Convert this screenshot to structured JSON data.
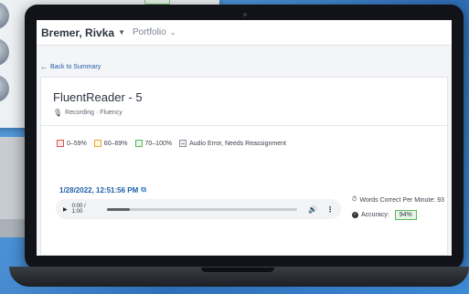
{
  "header": {
    "student_name": "Bremer, Rivka",
    "portfolio_label": "Portfolio"
  },
  "nav": {
    "back_label": "Back to Summary"
  },
  "assessment": {
    "title": "FluentReader - 5",
    "subtitle": "Recording · Fluency"
  },
  "legend": [
    {
      "label": "0–59%",
      "color": "#d9534f"
    },
    {
      "label": "60–69%",
      "color": "#e6a93a"
    },
    {
      "label": "70–100%",
      "color": "#5cb85c"
    },
    {
      "label": "Audio Error, Needs Reassignment",
      "color": "#8a929c"
    }
  ],
  "recording": {
    "timestamp": "1/28/2022, 12:51:56 PM",
    "player_time": "0:00 / 1:00",
    "progress_fraction": 0.12
  },
  "stats": {
    "wcpm_label": "Words Correct Per Minute: 93",
    "accuracy_label": "Accuracy:",
    "accuracy_value": "94%"
  },
  "icons": {
    "back": "arrow-left-icon",
    "mic": "microphone-icon",
    "camera": "video-camera-icon",
    "clock": "stopwatch-icon",
    "check": "check-circle-icon"
  }
}
